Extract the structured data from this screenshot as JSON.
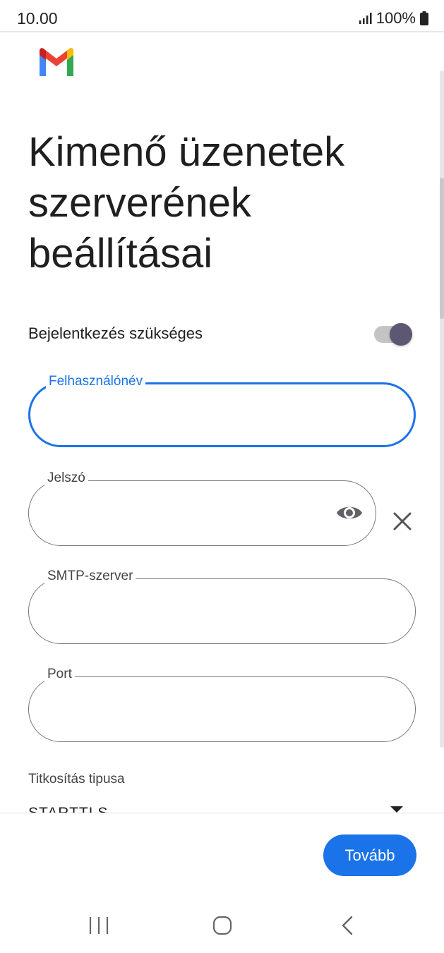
{
  "status_bar": {
    "time": "10.00",
    "battery": "100%"
  },
  "header": {
    "logo": "gmail-logo",
    "title": "Kimenő üzenetek szerverének beállításai"
  },
  "login_required": {
    "label": "Bejelentkezés szükséges",
    "enabled": true
  },
  "fields": {
    "username": {
      "label": "Felhasználónév",
      "value": ""
    },
    "password": {
      "label": "Jelszó",
      "value": ""
    },
    "smtp": {
      "label": "SMTP-szerver",
      "value": ""
    },
    "port": {
      "label": "Port",
      "value": ""
    }
  },
  "encryption": {
    "label": "Titkosítás tipusa",
    "value": "STARTTLS"
  },
  "actions": {
    "next_label": "Tovább"
  },
  "icons": {
    "signal": "signal-icon",
    "battery": "battery-icon",
    "eye": "eye-icon",
    "clear": "close-icon",
    "dropdown": "dropdown-arrow-icon",
    "recents": "recents-icon",
    "home": "home-icon",
    "back": "back-icon"
  },
  "colors": {
    "accent": "#1a73e8",
    "toggle_knob": "#5d5773"
  }
}
